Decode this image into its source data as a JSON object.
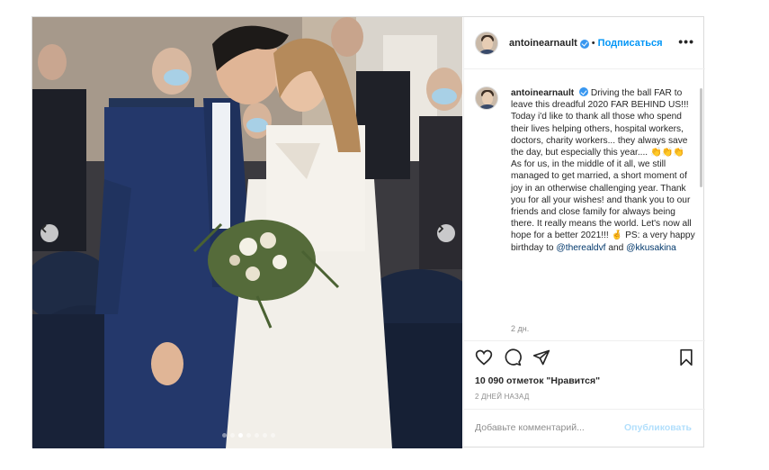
{
  "post": {
    "username": "antoinearnault",
    "follow_label": "Подписаться",
    "bullet": "•",
    "more_label": "•••",
    "caption_username": "antoinearnault",
    "caption_text_1": "Driving the ball FAR to leave this dreadful 2020 FAR BEHIND US!!! Today i'd like to thank all those who spend their lives helping others, hospital workers, doctors, charity workers... they always save the day, but especially this year.... ",
    "caption_emoji_1": "👏👏👏",
    "caption_text_2": " As for us, in the middle of it all, we still managed to get married, a short moment of joy in an otherwise challenging year. Thank you for all your wishes! and thank you to our friends and close family for always being there. It really means the world. Let's now all hope for a better 2021!!! ",
    "caption_emoji_2": "🤞",
    "caption_text_3": " PS: a very happy birthday to ",
    "mention_1": "@therealdvf",
    "caption_text_4": " and ",
    "mention_2": "@kkusakina",
    "time_ago": "2 дн.",
    "likes": "10 090 отметок \"Нравится\"",
    "date": "2 ДНЕЙ НАЗАД",
    "comment_placeholder": "Добавьте комментарий...",
    "publish_label": "Опубликовать"
  },
  "carousel": {
    "total_slides": 7,
    "active_slide": 2
  },
  "colors": {
    "accent": "#0095f6",
    "verified": "#3897f0",
    "publish_disabled": "#b2dffc",
    "muted_text": "#8e8e8e"
  },
  "icons": [
    "heart-icon",
    "comment-icon",
    "share-icon",
    "bookmark-icon",
    "chevron-left-icon",
    "chevron-right-icon",
    "verified-icon",
    "more-icon"
  ]
}
